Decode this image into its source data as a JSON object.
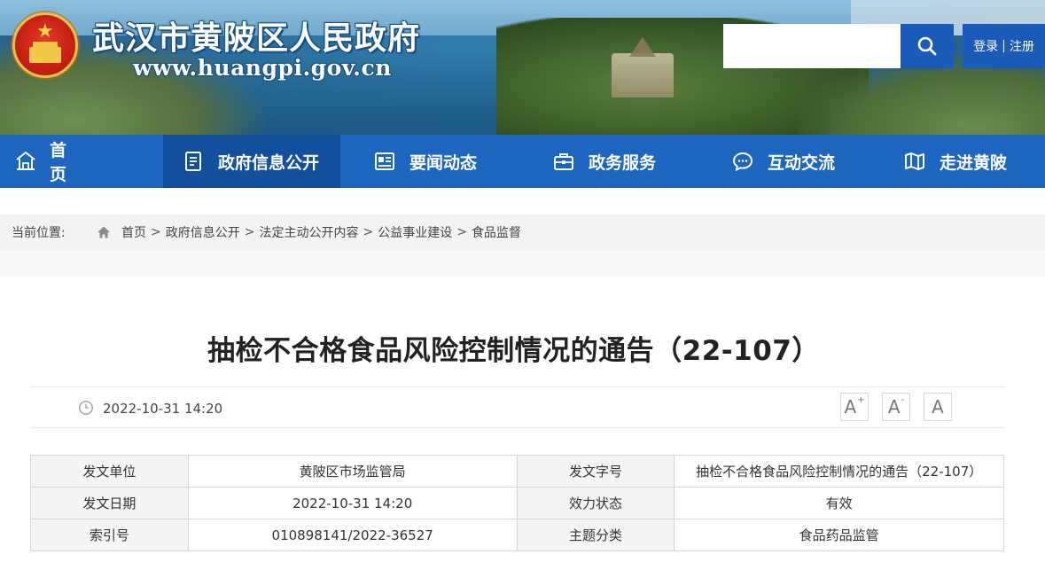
{
  "header": {
    "site_title": "武汉市黄陂区人民政府",
    "site_url": "www.huangpi.gov.cn",
    "search_placeholder": "",
    "login_label": "登录",
    "register_label": "注册",
    "separator": "|"
  },
  "nav": {
    "items": [
      {
        "label": "首页",
        "icon": "home-icon",
        "active": false
      },
      {
        "label": "政府信息公开",
        "icon": "document-icon",
        "active": true
      },
      {
        "label": "要闻动态",
        "icon": "news-icon",
        "active": false
      },
      {
        "label": "政务服务",
        "icon": "briefcase-icon",
        "active": false
      },
      {
        "label": "互动交流",
        "icon": "chat-icon",
        "active": false
      },
      {
        "label": "走进黄陂",
        "icon": "map-icon",
        "active": false
      }
    ]
  },
  "breadcrumb": {
    "prefix": "当前位置:",
    "items": [
      "首页",
      "政府信息公开",
      "法定主动公开内容",
      "公益事业建设",
      "食品监督"
    ],
    "separator": ">"
  },
  "article": {
    "title": "抽检不合格食品风险控制情况的通告（22-107）",
    "datetime": "2022-10-31 14:20",
    "font_controls": {
      "increase": "A",
      "increase_sup": "+",
      "decrease": "A",
      "decrease_sup": "-",
      "normal": "A"
    }
  },
  "info_table": {
    "rows": [
      {
        "k1": "发文单位",
        "v1": "黄陂区市场监管局",
        "k2": "发文字号",
        "v2": "抽检不合格食品风险控制情况的通告（22-107）"
      },
      {
        "k1": "发文日期",
        "v1": "2022-10-31 14:20",
        "k2": "效力状态",
        "v2": "有效"
      },
      {
        "k1": "索引号",
        "v1": "010898141/2022-36527",
        "k2": "主题分类",
        "v2": "食品药品监管"
      }
    ]
  },
  "colors": {
    "nav_bg": "#1c66bf",
    "nav_active_bg": "#124f9c",
    "search_button_bg": "#1a5ab8"
  }
}
